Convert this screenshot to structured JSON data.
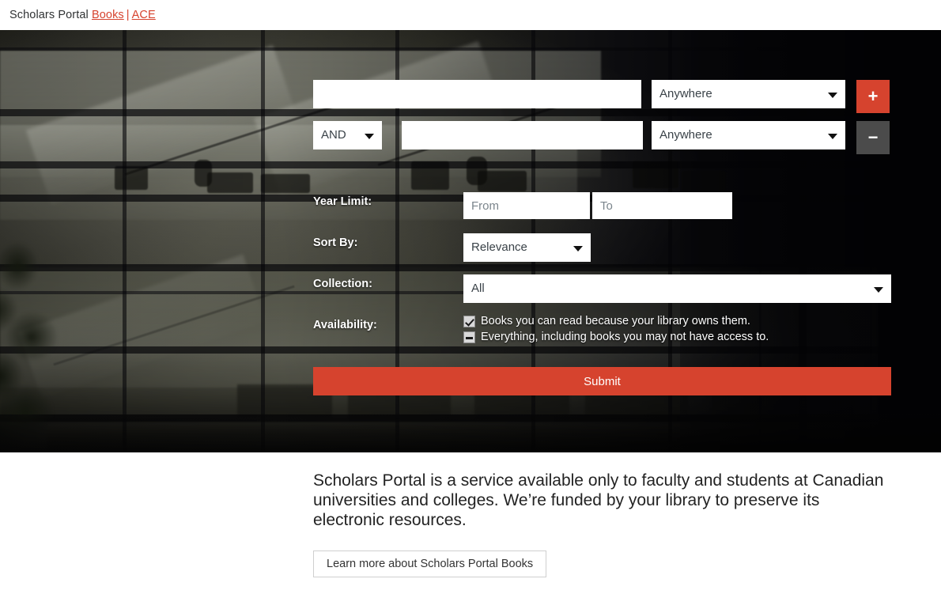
{
  "header": {
    "brand_main": "Scholars Portal",
    "brand_books": "Books",
    "separator": "|",
    "brand_ace": "ACE"
  },
  "search_form": {
    "row1": {
      "query_value": "",
      "query_placeholder": "",
      "field_selected": "Anywhere",
      "add_row_label": "+"
    },
    "row2": {
      "boolean_selected": "AND",
      "query_value": "",
      "query_placeholder": "",
      "field_selected": "Anywhere",
      "remove_row_label": "−"
    },
    "year_limit": {
      "label": "Year Limit:",
      "from_value": "",
      "from_placeholder": "From",
      "to_value": "",
      "to_placeholder": "To"
    },
    "sort_by": {
      "label": "Sort By:",
      "selected": "Relevance"
    },
    "collection": {
      "label": "Collection:",
      "selected": "All"
    },
    "availability": {
      "label": "Availability:",
      "options": [
        {
          "text": "Books you can read because your library owns them.",
          "state": "checked"
        },
        {
          "text": "Everything, including books you may not have access to.",
          "state": "dash"
        }
      ]
    },
    "submit_label": "Submit"
  },
  "info": {
    "blurb": "Scholars Portal is a service available only to faculty and students at Canadian universities and colleges. We’re funded by your library to preserve its electronic resources.",
    "learn_more_label": "Learn more about Scholars Portal Books"
  },
  "colors": {
    "accent_red": "#d6432e",
    "remove_gray": "#4b4b4b",
    "text_dark": "#232323"
  }
}
